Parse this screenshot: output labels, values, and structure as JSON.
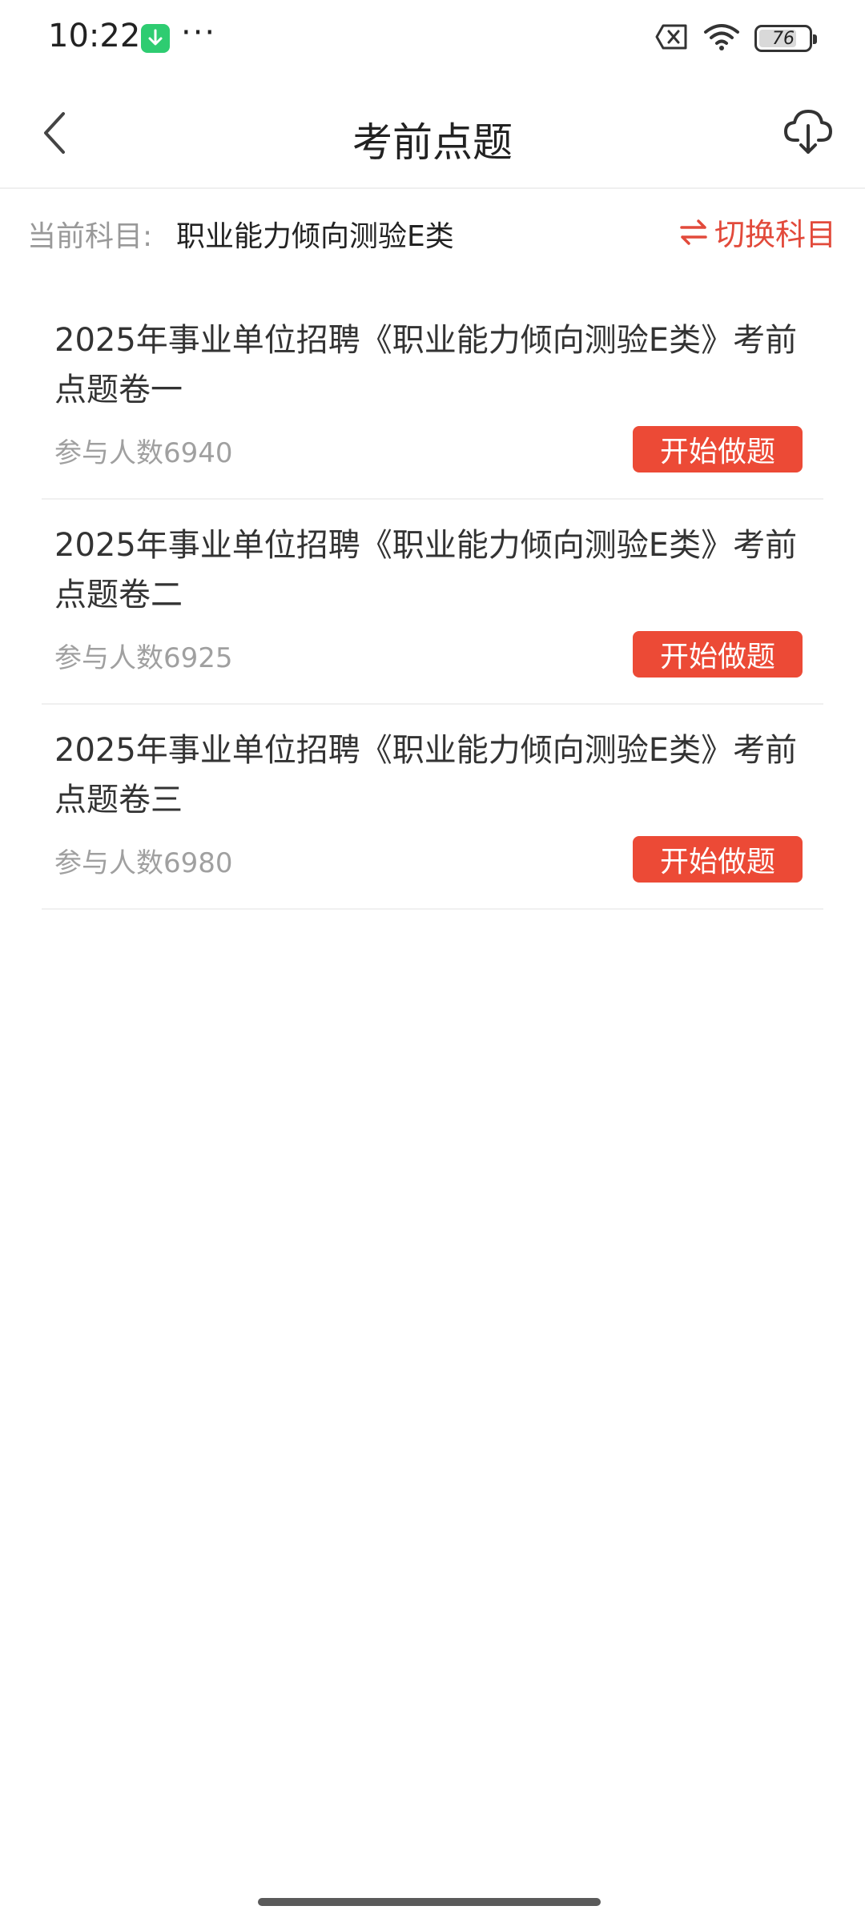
{
  "status_bar": {
    "time": "10:22",
    "more": "···",
    "battery": "76",
    "battery_level": 0.76,
    "icons": [
      "download-notification-icon",
      "sim-no-signal-icon",
      "wifi-icon",
      "battery-icon"
    ]
  },
  "nav": {
    "title": "考前点题",
    "back_icon": "chevron-left-icon",
    "download_icon": "cloud-download-icon"
  },
  "subject": {
    "label": "当前科目:",
    "value": "职业能力倾向测验E类",
    "switch_label": "切换科目",
    "switch_icon": "swap-arrows-icon"
  },
  "papers": [
    {
      "title": "2025年事业单位招聘《职业能力倾向测验E类》考前点题卷一",
      "count": "参与人数6940",
      "button": "开始做题"
    },
    {
      "title": "2025年事业单位招聘《职业能力倾向测验E类》考前点题卷二",
      "count": "参与人数6925",
      "button": "开始做题"
    },
    {
      "title": "2025年事业单位招聘《职业能力倾向测验E类》考前点题卷三",
      "count": "参与人数6980",
      "button": "开始做题"
    }
  ],
  "colors": {
    "accent": "#e24a3b",
    "button_bg": "#ec4a36",
    "muted_text": "#999999"
  }
}
